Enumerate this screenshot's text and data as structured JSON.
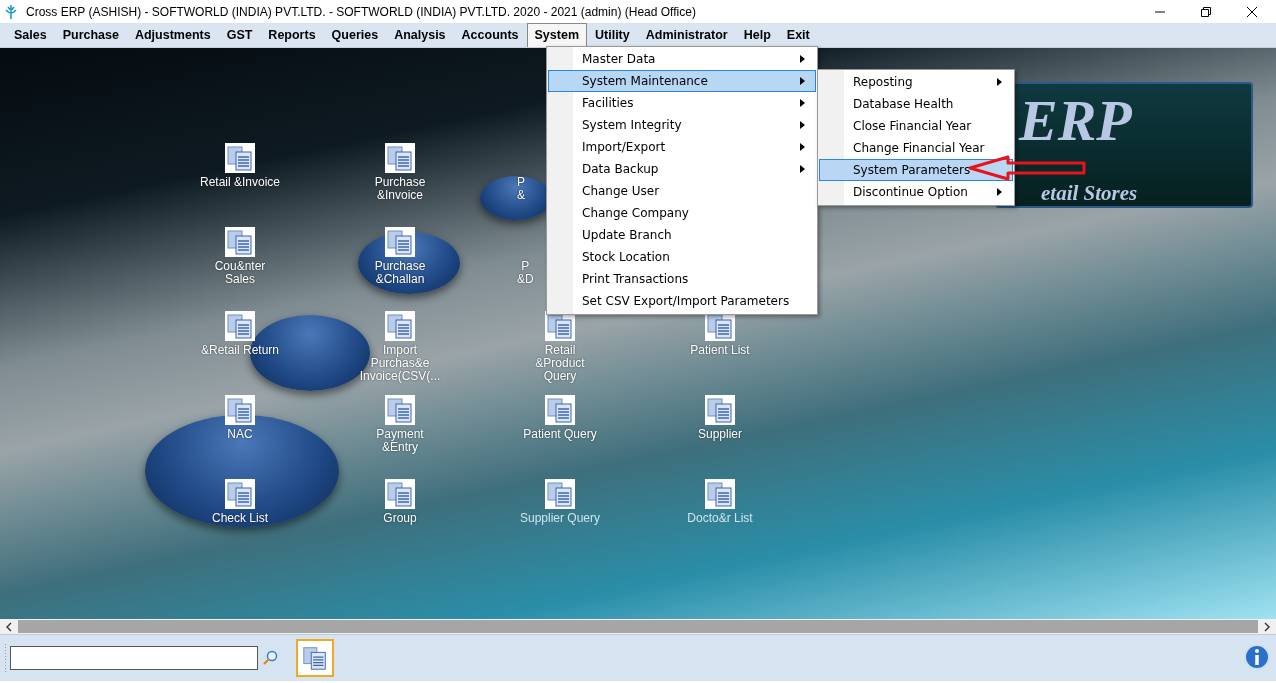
{
  "window": {
    "title": "Cross ERP (ASHISH) - SOFTWORLD (INDIA) PVT.LTD. - SOFTWORLD (INDIA) PVT.LTD.  2020 - 2021 (admin) (Head Office)"
  },
  "menu_bar": [
    {
      "label": "Sales",
      "selected": false
    },
    {
      "label": "Purchase",
      "selected": false
    },
    {
      "label": "Adjustments",
      "selected": false
    },
    {
      "label": "GST",
      "selected": false
    },
    {
      "label": "Reports",
      "selected": false
    },
    {
      "label": "Queries",
      "selected": false
    },
    {
      "label": "Analysis",
      "selected": false
    },
    {
      "label": "Accounts",
      "selected": false
    },
    {
      "label": "System",
      "selected": true
    },
    {
      "label": "Utility",
      "selected": false
    },
    {
      "label": "Administrator",
      "selected": false
    },
    {
      "label": "Help",
      "selected": false
    },
    {
      "label": "Exit",
      "selected": false
    }
  ],
  "system_menu": {
    "items": [
      {
        "label": "Master Data",
        "submenu": true,
        "selected": false
      },
      {
        "label": "System Maintenance",
        "submenu": true,
        "selected": true
      },
      {
        "label": "Facilities",
        "submenu": true,
        "selected": false
      },
      {
        "label": "System Integrity",
        "submenu": true,
        "selected": false
      },
      {
        "label": "Import/Export",
        "submenu": true,
        "selected": false
      },
      {
        "label": "Data Backup",
        "submenu": true,
        "selected": false
      },
      {
        "label": "Change User",
        "submenu": false,
        "selected": false
      },
      {
        "label": "Change Company",
        "submenu": false,
        "selected": false
      },
      {
        "label": "Update Branch",
        "submenu": false,
        "selected": false
      },
      {
        "label": "Stock Location",
        "submenu": false,
        "selected": false
      },
      {
        "label": "Print Transactions",
        "submenu": false,
        "selected": false
      },
      {
        "label": "Set CSV Export/Import Parameters",
        "submenu": false,
        "selected": false
      }
    ]
  },
  "submenu": {
    "items": [
      {
        "label": "Reposting",
        "submenu": true,
        "selected": false
      },
      {
        "label": "Database Health",
        "submenu": false,
        "selected": false
      },
      {
        "label": "Close Financial Year",
        "submenu": false,
        "selected": false
      },
      {
        "label": "Change Financial Year",
        "submenu": false,
        "selected": false
      },
      {
        "label": "System Parameters",
        "submenu": false,
        "selected": true
      },
      {
        "label": "Discontinue Option",
        "submenu": true,
        "selected": false
      }
    ]
  },
  "logo": {
    "title": "ERP",
    "subtitle": "etail Stores"
  },
  "desktop": {
    "rows": [
      {
        "items": [
          {
            "kind": "icon",
            "lines": [
              "Retail &Invoice"
            ]
          },
          {
            "kind": "icon",
            "lines": [
              "Purchase",
              "&Invoice"
            ]
          },
          {
            "kind": "covered",
            "lines": [
              "P",
              "&"
            ]
          }
        ]
      },
      {
        "items": [
          {
            "kind": "icon",
            "lines": [
              "Cou&nter",
              "Sales"
            ]
          },
          {
            "kind": "icon",
            "lines": [
              "Purchase",
              "&Challan"
            ]
          },
          {
            "kind": "covered",
            "lines": [
              "P",
              "&D"
            ]
          }
        ]
      },
      {
        "items": [
          {
            "kind": "icon",
            "lines": [
              "&Retail Return"
            ]
          },
          {
            "kind": "icon",
            "lines": [
              "Import",
              "Purchas&e",
              "Invoice(CSV(..."
            ]
          },
          {
            "kind": "icon",
            "lines": [
              "Retail",
              "&Product",
              "Query"
            ]
          },
          {
            "kind": "icon",
            "lines": [
              "Patient List"
            ]
          }
        ]
      },
      {
        "items": [
          {
            "kind": "icon",
            "lines": [
              "NAC"
            ]
          },
          {
            "kind": "icon",
            "lines": [
              "Payment",
              "&Entry"
            ]
          },
          {
            "kind": "icon",
            "lines": [
              "Patient Query"
            ]
          },
          {
            "kind": "icon",
            "lines": [
              "Supplier"
            ]
          }
        ]
      },
      {
        "items": [
          {
            "kind": "icon",
            "lines": [
              "Check List"
            ]
          },
          {
            "kind": "icon",
            "lines": [
              "Group"
            ]
          },
          {
            "kind": "faded",
            "lines": [
              "Supplier Query"
            ]
          },
          {
            "kind": "faded",
            "lines": [
              "Docto&r List"
            ]
          }
        ]
      }
    ]
  },
  "toolbar": {
    "shortcut": {
      "selected": true
    }
  }
}
